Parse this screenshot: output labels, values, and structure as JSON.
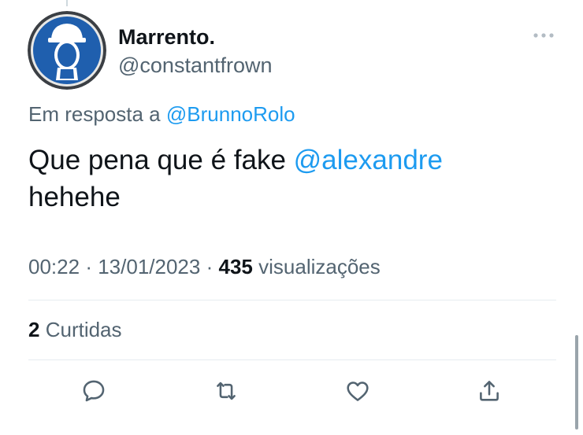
{
  "tweet": {
    "display_name": "Marrento.",
    "handle": "@constantfrown",
    "reply_prefix": "Em resposta a",
    "reply_to": "@BrunnoRolo",
    "text_before": "Que pena que é fake ",
    "text_mention": "@alexandre",
    "text_after": "hehehe",
    "time": "00:22",
    "separator": "·",
    "date": "13/01/2023",
    "views_count": "435",
    "views_label": "visualizações",
    "likes_count": "2",
    "likes_label": "Curtidas"
  },
  "actions": [
    {
      "name": "reply",
      "icon": "speech-bubble-icon"
    },
    {
      "name": "retweet",
      "icon": "retweet-icon"
    },
    {
      "name": "like",
      "icon": "heart-icon"
    },
    {
      "name": "share",
      "icon": "share-upload-icon"
    }
  ],
  "colors": {
    "link": "#1d9bf0",
    "secondary_text": "#536471",
    "primary_text": "#0f1419",
    "avatar_blue": "#1f5fae"
  }
}
